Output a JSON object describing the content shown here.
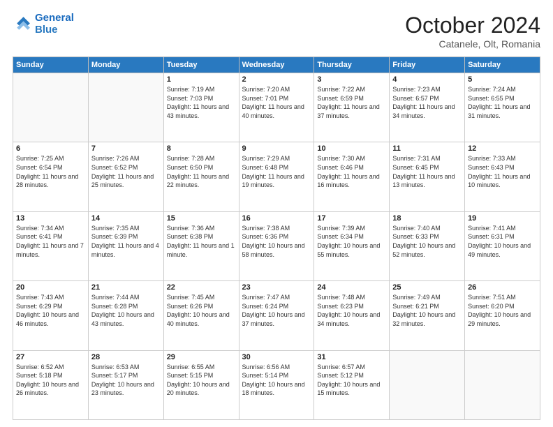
{
  "header": {
    "logo_line1": "General",
    "logo_line2": "Blue",
    "month": "October 2024",
    "location": "Catanele, Olt, Romania"
  },
  "weekdays": [
    "Sunday",
    "Monday",
    "Tuesday",
    "Wednesday",
    "Thursday",
    "Friday",
    "Saturday"
  ],
  "weeks": [
    [
      {
        "day": "",
        "sunrise": "",
        "sunset": "",
        "daylight": ""
      },
      {
        "day": "",
        "sunrise": "",
        "sunset": "",
        "daylight": ""
      },
      {
        "day": "1",
        "sunrise": "Sunrise: 7:19 AM",
        "sunset": "Sunset: 7:03 PM",
        "daylight": "Daylight: 11 hours and 43 minutes."
      },
      {
        "day": "2",
        "sunrise": "Sunrise: 7:20 AM",
        "sunset": "Sunset: 7:01 PM",
        "daylight": "Daylight: 11 hours and 40 minutes."
      },
      {
        "day": "3",
        "sunrise": "Sunrise: 7:22 AM",
        "sunset": "Sunset: 6:59 PM",
        "daylight": "Daylight: 11 hours and 37 minutes."
      },
      {
        "day": "4",
        "sunrise": "Sunrise: 7:23 AM",
        "sunset": "Sunset: 6:57 PM",
        "daylight": "Daylight: 11 hours and 34 minutes."
      },
      {
        "day": "5",
        "sunrise": "Sunrise: 7:24 AM",
        "sunset": "Sunset: 6:55 PM",
        "daylight": "Daylight: 11 hours and 31 minutes."
      }
    ],
    [
      {
        "day": "6",
        "sunrise": "Sunrise: 7:25 AM",
        "sunset": "Sunset: 6:54 PM",
        "daylight": "Daylight: 11 hours and 28 minutes."
      },
      {
        "day": "7",
        "sunrise": "Sunrise: 7:26 AM",
        "sunset": "Sunset: 6:52 PM",
        "daylight": "Daylight: 11 hours and 25 minutes."
      },
      {
        "day": "8",
        "sunrise": "Sunrise: 7:28 AM",
        "sunset": "Sunset: 6:50 PM",
        "daylight": "Daylight: 11 hours and 22 minutes."
      },
      {
        "day": "9",
        "sunrise": "Sunrise: 7:29 AM",
        "sunset": "Sunset: 6:48 PM",
        "daylight": "Daylight: 11 hours and 19 minutes."
      },
      {
        "day": "10",
        "sunrise": "Sunrise: 7:30 AM",
        "sunset": "Sunset: 6:46 PM",
        "daylight": "Daylight: 11 hours and 16 minutes."
      },
      {
        "day": "11",
        "sunrise": "Sunrise: 7:31 AM",
        "sunset": "Sunset: 6:45 PM",
        "daylight": "Daylight: 11 hours and 13 minutes."
      },
      {
        "day": "12",
        "sunrise": "Sunrise: 7:33 AM",
        "sunset": "Sunset: 6:43 PM",
        "daylight": "Daylight: 11 hours and 10 minutes."
      }
    ],
    [
      {
        "day": "13",
        "sunrise": "Sunrise: 7:34 AM",
        "sunset": "Sunset: 6:41 PM",
        "daylight": "Daylight: 11 hours and 7 minutes."
      },
      {
        "day": "14",
        "sunrise": "Sunrise: 7:35 AM",
        "sunset": "Sunset: 6:39 PM",
        "daylight": "Daylight: 11 hours and 4 minutes."
      },
      {
        "day": "15",
        "sunrise": "Sunrise: 7:36 AM",
        "sunset": "Sunset: 6:38 PM",
        "daylight": "Daylight: 11 hours and 1 minute."
      },
      {
        "day": "16",
        "sunrise": "Sunrise: 7:38 AM",
        "sunset": "Sunset: 6:36 PM",
        "daylight": "Daylight: 10 hours and 58 minutes."
      },
      {
        "day": "17",
        "sunrise": "Sunrise: 7:39 AM",
        "sunset": "Sunset: 6:34 PM",
        "daylight": "Daylight: 10 hours and 55 minutes."
      },
      {
        "day": "18",
        "sunrise": "Sunrise: 7:40 AM",
        "sunset": "Sunset: 6:33 PM",
        "daylight": "Daylight: 10 hours and 52 minutes."
      },
      {
        "day": "19",
        "sunrise": "Sunrise: 7:41 AM",
        "sunset": "Sunset: 6:31 PM",
        "daylight": "Daylight: 10 hours and 49 minutes."
      }
    ],
    [
      {
        "day": "20",
        "sunrise": "Sunrise: 7:43 AM",
        "sunset": "Sunset: 6:29 PM",
        "daylight": "Daylight: 10 hours and 46 minutes."
      },
      {
        "day": "21",
        "sunrise": "Sunrise: 7:44 AM",
        "sunset": "Sunset: 6:28 PM",
        "daylight": "Daylight: 10 hours and 43 minutes."
      },
      {
        "day": "22",
        "sunrise": "Sunrise: 7:45 AM",
        "sunset": "Sunset: 6:26 PM",
        "daylight": "Daylight: 10 hours and 40 minutes."
      },
      {
        "day": "23",
        "sunrise": "Sunrise: 7:47 AM",
        "sunset": "Sunset: 6:24 PM",
        "daylight": "Daylight: 10 hours and 37 minutes."
      },
      {
        "day": "24",
        "sunrise": "Sunrise: 7:48 AM",
        "sunset": "Sunset: 6:23 PM",
        "daylight": "Daylight: 10 hours and 34 minutes."
      },
      {
        "day": "25",
        "sunrise": "Sunrise: 7:49 AM",
        "sunset": "Sunset: 6:21 PM",
        "daylight": "Daylight: 10 hours and 32 minutes."
      },
      {
        "day": "26",
        "sunrise": "Sunrise: 7:51 AM",
        "sunset": "Sunset: 6:20 PM",
        "daylight": "Daylight: 10 hours and 29 minutes."
      }
    ],
    [
      {
        "day": "27",
        "sunrise": "Sunrise: 6:52 AM",
        "sunset": "Sunset: 5:18 PM",
        "daylight": "Daylight: 10 hours and 26 minutes."
      },
      {
        "day": "28",
        "sunrise": "Sunrise: 6:53 AM",
        "sunset": "Sunset: 5:17 PM",
        "daylight": "Daylight: 10 hours and 23 minutes."
      },
      {
        "day": "29",
        "sunrise": "Sunrise: 6:55 AM",
        "sunset": "Sunset: 5:15 PM",
        "daylight": "Daylight: 10 hours and 20 minutes."
      },
      {
        "day": "30",
        "sunrise": "Sunrise: 6:56 AM",
        "sunset": "Sunset: 5:14 PM",
        "daylight": "Daylight: 10 hours and 18 minutes."
      },
      {
        "day": "31",
        "sunrise": "Sunrise: 6:57 AM",
        "sunset": "Sunset: 5:12 PM",
        "daylight": "Daylight: 10 hours and 15 minutes."
      },
      {
        "day": "",
        "sunrise": "",
        "sunset": "",
        "daylight": ""
      },
      {
        "day": "",
        "sunrise": "",
        "sunset": "",
        "daylight": ""
      }
    ]
  ]
}
